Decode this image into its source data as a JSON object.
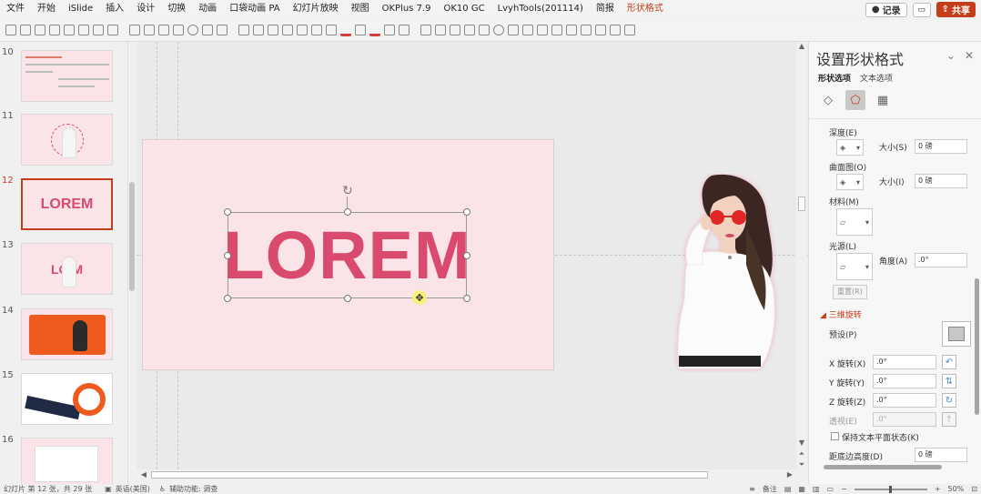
{
  "menu": {
    "items": [
      "文件",
      "开始",
      "iSlide",
      "插入",
      "设计",
      "切换",
      "动画",
      "口袋动画 PA",
      "幻灯片放映",
      "视图",
      "OKPlus 7.9",
      "OK10 GC",
      "LvyhTools(201114)",
      "简报",
      "形状格式"
    ],
    "record_label": "记录",
    "share_label": "共享"
  },
  "slides": {
    "items": [
      {
        "num": "10"
      },
      {
        "num": "11"
      },
      {
        "num": "12",
        "text": "LOREM"
      },
      {
        "num": "13",
        "text": "LO    M"
      },
      {
        "num": "14"
      },
      {
        "num": "15"
      },
      {
        "num": "16"
      }
    ]
  },
  "canvas": {
    "main_text": "LOREM",
    "text_color": "#d94a6e",
    "slide_bg": "#fbe4e7"
  },
  "panel": {
    "title": "设置形状格式",
    "tabs": [
      "形状选项",
      "文本选项"
    ],
    "depth_label": "深度(E)",
    "size_label_1": "大小(S)",
    "size_value_1": "0 磅",
    "contour_label": "曲面图(O)",
    "size_label_2": "大小(I)",
    "size_value_2": "0 磅",
    "material_label": "材料(M)",
    "lighting_label": "光源(L)",
    "angle_label": "角度(A)",
    "angle_value": ".0°",
    "reset_label": "重置(R)",
    "rotation_section": "三维旋转",
    "preset_label": "预设(P)",
    "x_label": "X 旋转(X)",
    "x_value": ".0°",
    "y_label": "Y 旋转(Y)",
    "y_value": ".0°",
    "z_label": "Z 旋转(Z)",
    "z_value": ".0°",
    "perspective_label": "透视(E)",
    "perspective_value": ".0°",
    "keep_flat_label": "保持文本平面状态(K)",
    "distance_label": "距底边高度(D)",
    "distance_value": "0 磅"
  },
  "status": {
    "slide_info": "幻灯片 第 12 张，共 29 张",
    "language": "英语(美国)",
    "accessibility": "辅助功能: 调查",
    "notes": "备注",
    "zoom": "50%"
  },
  "colors": {
    "accent": "#c43e1c",
    "brand_pink": "#d94a6e"
  }
}
